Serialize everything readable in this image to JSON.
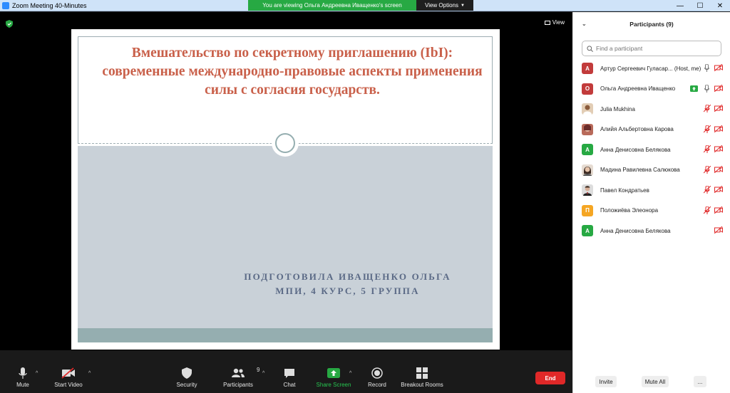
{
  "window": {
    "title": "Zoom Meeting 40-Minutes",
    "minimize": "—",
    "maximize": "☐",
    "close": "✕"
  },
  "banner": {
    "viewing": "You are viewing Ольга Андреевна Иващенко's screen",
    "view_options": "View Options"
  },
  "video": {
    "view_label": "View"
  },
  "slide": {
    "title": "Вмешательство по секретному приглашению (IbI): современные международно-правовые аспекты применения силы с согласия государств.",
    "subtitle_line1": "ПОДГОТОВИЛА ИВАЩЕНКО ОЛЬГА",
    "subtitle_line2": "МПИ, 4 КУРС, 5 ГРУППА"
  },
  "toolbar": {
    "mute": "Mute",
    "start_video": "Start Video",
    "security": "Security",
    "participants": "Participants",
    "participants_count": "9",
    "chat": "Chat",
    "share_screen": "Share Screen",
    "record": "Record",
    "breakout_rooms": "Breakout Rooms",
    "end": "End"
  },
  "panel": {
    "title": "Participants (9)",
    "search_placeholder": "Find a participant",
    "participants": [
      {
        "initial": "А",
        "name": "Артур Сергеевич Гуласар... (Host, me)",
        "color": "#c23b3b",
        "photo": false
      },
      {
        "initial": "О",
        "name": "Ольга Андреевна Иващенко",
        "color": "#c23b3b",
        "photo": false
      },
      {
        "initial": "",
        "name": "Julia Mukhina",
        "color": "#d8c0a8",
        "photo": true
      },
      {
        "initial": "",
        "name": "Алийя Альбертовна Карова",
        "color": "#b86a5a",
        "photo": true
      },
      {
        "initial": "А",
        "name": "Анна Денисовна Белякова",
        "color": "#27a943",
        "photo": false
      },
      {
        "initial": "",
        "name": "Мадина Равилевна Салюкова",
        "color": "#cdbfb3",
        "photo": true
      },
      {
        "initial": "",
        "name": "Павел Кондратьев",
        "color": "#c9c9c9",
        "photo": true
      },
      {
        "initial": "П",
        "name": "Положиёва Элеонора",
        "color": "#f5a623",
        "photo": false
      },
      {
        "initial": "А",
        "name": "Анна Денисовна Белякова",
        "color": "#27a943",
        "photo": false
      }
    ],
    "invite": "Invite",
    "mute_all": "Mute All",
    "more": "..."
  },
  "colors": {
    "accent_green": "#27a943",
    "end_red": "#e02828",
    "slide_title": "#c9604a",
    "slide_subtitle": "#5b6a86",
    "muted_red": "#e02828"
  }
}
